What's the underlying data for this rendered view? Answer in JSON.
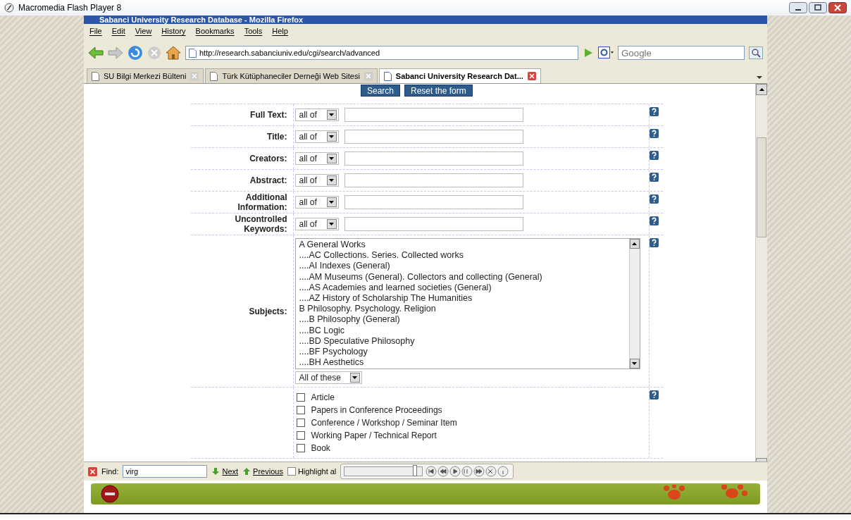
{
  "player": {
    "title": "Macromedia Flash Player 8"
  },
  "browser": {
    "title": "Sabanci University Research Database - Mozilla Firefox",
    "menu": [
      "File",
      "Edit",
      "View",
      "History",
      "Bookmarks",
      "Tools",
      "Help"
    ],
    "address": "http://research.sabanciuniv.edu/cgi/search/advanced",
    "search_placeholder": "Google",
    "tabs": [
      {
        "label": "SU Bilgi Merkezi Bülteni",
        "selected": false
      },
      {
        "label": "Türk Kütüphaneciler Derneği Web Sitesi",
        "selected": false
      },
      {
        "label": "Sabanci University Research Dat...",
        "selected": true
      }
    ]
  },
  "page": {
    "top_buttons": [
      "Search",
      "Reset the form"
    ],
    "fields": [
      {
        "label": "Full Text:",
        "match": "all of"
      },
      {
        "label": "Title:",
        "match": "all of"
      },
      {
        "label": "Creators:",
        "match": "all of"
      },
      {
        "label": "Abstract:",
        "match": "all of"
      },
      {
        "label": "Additional Information:",
        "match": "all of"
      },
      {
        "label": "Uncontrolled Keywords:",
        "match": "all of"
      }
    ],
    "subjects": {
      "label": "Subjects:",
      "match": "All of these",
      "options": [
        "A General Works",
        "....AC Collections. Series. Collected works",
        "....AI Indexes (General)",
        "....AM Museums (General). Collectors and collecting (General)",
        "....AS Academies and learned societies (General)",
        "....AZ History of Scholarship The Humanities",
        "B Philosophy. Psychology. Religion",
        "....B Philosophy (General)",
        "....BC Logic",
        "....BD Speculative Philosophy",
        "....BF Psychology",
        "....BH Aesthetics"
      ]
    },
    "types": [
      {
        "label": "Article",
        "checked": false
      },
      {
        "label": "Papers in Conference Proceedings",
        "checked": false
      },
      {
        "label": "Conference / Workshop / Seminar Item",
        "checked": false
      },
      {
        "label": "Working Paper / Technical Report",
        "checked": false
      },
      {
        "label": "Book",
        "checked": false
      }
    ]
  },
  "find_bar": {
    "label": "Find:",
    "value": "virg",
    "next": "Next",
    "previous": "Previous",
    "highlight": "Highlight al",
    "highlight_checked": false
  },
  "media": {
    "level": 0.93
  }
}
